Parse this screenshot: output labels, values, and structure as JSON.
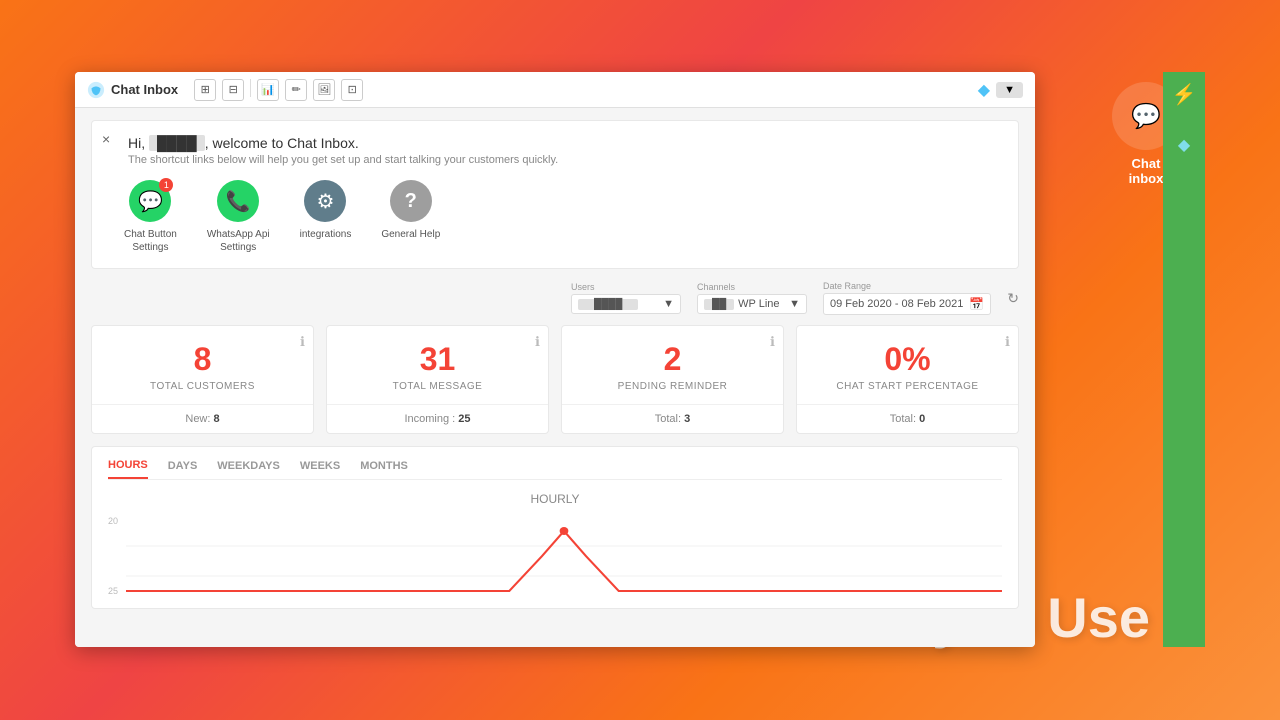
{
  "app": {
    "title": "Chat Inbox",
    "logo_text": "Chat Inbox"
  },
  "titlebar": {
    "title": "Chat Inbox",
    "diamond_symbol": "◆",
    "toggle_label": "▼"
  },
  "toolbar": {
    "buttons": [
      "⊞",
      "⊟",
      "⊠",
      "⊡",
      "⊢",
      "⊣"
    ]
  },
  "welcome": {
    "close_label": "×",
    "greeting": "Hi,",
    "username": "User",
    "title": "Hi, [user], welcome to Chat Inbox.",
    "subtitle": "The shortcut links below will help you get set up and start talking your customers quickly.",
    "links": [
      {
        "id": "chat-button-settings",
        "label": "Chat Button\nSettings",
        "icon": "💬",
        "badge": "1",
        "bg": "#25d366"
      },
      {
        "id": "whatsapp-api-settings",
        "label": "WhatsApp Api\nSettings",
        "icon": "📞",
        "badge": null,
        "bg": "#25d366"
      },
      {
        "id": "integrations",
        "label": "Integrations",
        "icon": "⚙",
        "badge": null,
        "bg": "#607d8b"
      },
      {
        "id": "general-help",
        "label": "General Help",
        "icon": "?",
        "badge": null,
        "bg": "#9e9e9e"
      }
    ]
  },
  "filters": {
    "users_label": "Users",
    "users_value": "All Users",
    "channels_label": "Channels",
    "channels_value": "WP Line",
    "date_range_label": "Date Range",
    "date_range_value": "09 Feb 2020 - 08 Feb 2021"
  },
  "stats": [
    {
      "id": "total-customers",
      "value": "8",
      "label": "TOTAL CUSTOMERS",
      "footer_label": "New:",
      "footer_value": "8"
    },
    {
      "id": "total-message",
      "value": "31",
      "label": "TOTAL MESSAGE",
      "footer_label": "Incoming :",
      "footer_value": "25"
    },
    {
      "id": "pending-reminder",
      "value": "2",
      "label": "PENDING REMINDER",
      "footer_label": "Total:",
      "footer_value": "3"
    },
    {
      "id": "chat-start-percentage",
      "value": "0%",
      "label": "CHAT START PERCENTAGE",
      "footer_label": "Total:",
      "footer_value": "0"
    }
  ],
  "chart": {
    "tabs": [
      "HOURS",
      "DAYS",
      "WEEKDAYS",
      "WEEKS",
      "MONTHS"
    ],
    "active_tab": "HOURS",
    "title": "HOURLY",
    "y_labels": [
      "25",
      "20"
    ],
    "line_color": "#f44336"
  },
  "sidebar_right": {
    "power_icon": "⚡",
    "diamond_icon": "◆"
  },
  "promo_text": "Easy to Use",
  "chat_inbox_right": {
    "title": "Chat",
    "subtitle": "inbox"
  }
}
